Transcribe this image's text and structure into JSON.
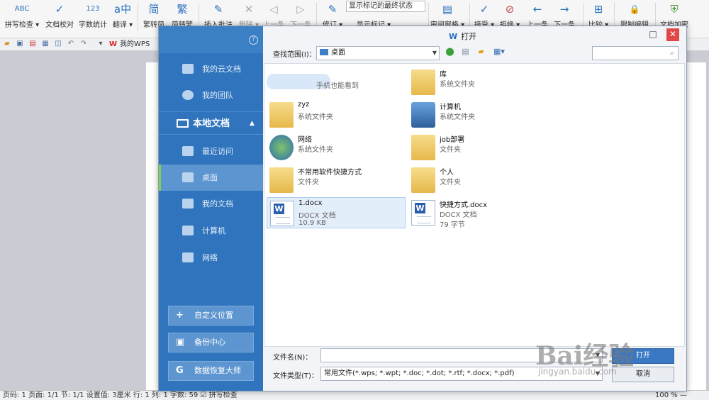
{
  "ribbon": [
    {
      "label": "拼写检查 ▾",
      "icon": "spell-check-icon",
      "glyph": "ABC"
    },
    {
      "label": "文档校对",
      "icon": "proofread-icon",
      "glyph": "✓"
    },
    {
      "label": "字数统计",
      "icon": "word-count-icon",
      "glyph": "123"
    },
    {
      "label": "翻译 ▾",
      "icon": "translate-icon",
      "glyph": "a中"
    },
    {
      "label": "繁转简",
      "icon": "trad-to-simp-icon",
      "glyph": "简"
    },
    {
      "label": "简转繁",
      "icon": "simp-to-trad-icon",
      "glyph": "繁"
    },
    {
      "label": "插入批注",
      "icon": "insert-comment-icon",
      "glyph": "✎"
    },
    {
      "label": "删除 ▾",
      "icon": "delete-comment-icon",
      "glyph": "✕"
    },
    {
      "label": "上一条",
      "icon": "prev-comment-icon",
      "glyph": "◁"
    },
    {
      "label": "下一条",
      "icon": "next-comment-icon",
      "glyph": "▷"
    },
    {
      "label": "修订 ▾",
      "icon": "track-changes-icon",
      "glyph": "✎"
    },
    {
      "label": "审阅窗格 ▾",
      "icon": "review-pane-icon",
      "glyph": "▤"
    },
    {
      "label": "接受 ▾",
      "icon": "accept-icon",
      "glyph": "✓"
    },
    {
      "label": "拒绝 ▾",
      "icon": "reject-icon",
      "glyph": "⊘"
    },
    {
      "label": "上一条",
      "icon": "prev-change-icon",
      "glyph": "←"
    },
    {
      "label": "下一条",
      "icon": "next-change-icon",
      "glyph": "→"
    },
    {
      "label": "比较 ▾",
      "icon": "compare-icon",
      "glyph": "⊞"
    },
    {
      "label": "限制编辑",
      "icon": "restrict-edit-icon",
      "glyph": "🔒"
    },
    {
      "label": "文档加密",
      "icon": "encrypt-icon",
      "glyph": "⛨"
    }
  ],
  "ribbon_markup_state": "显示标记的最终状态",
  "ribbon_show_markup": "显示标记 ▾",
  "qat": {
    "wps_tab": "我的WPS"
  },
  "statusbar": "页码: 1   页面: 1/1   节: 1/1   设置值: 3厘米   行: 1   列: 1   字数: 59   ☑ 拼写检查",
  "statusbar_zoom": "100 % —",
  "sidebar": {
    "help": "?",
    "items": [
      {
        "label": "我的云文档",
        "icon": "cloud-docs-icon"
      },
      {
        "label": "我的团队",
        "icon": "team-icon"
      },
      {
        "label": "最近访问",
        "icon": "recent-icon"
      },
      {
        "label": "桌面",
        "icon": "desktop-icon"
      },
      {
        "label": "我的文档",
        "icon": "my-docs-icon"
      },
      {
        "label": "计算机",
        "icon": "computer-icon"
      },
      {
        "label": "网络",
        "icon": "network-icon"
      }
    ],
    "section": "本地文档",
    "section_arrow": "▲",
    "buttons": [
      {
        "label": "自定义位置",
        "glyph": "+"
      },
      {
        "label": "备份中心",
        "glyph": "▣"
      },
      {
        "label": "数据恢复大师",
        "glyph": "G"
      }
    ]
  },
  "dialog": {
    "title": "打开",
    "title_icon": "W",
    "lookin_label": "查找范围(I)：",
    "lookin_value": "桌面",
    "filename_label": "文件名(N)：",
    "filename_value": "",
    "filetype_label": "文件类型(T)：",
    "filetype_value": "常用文件(*.wps; *.wpt; *.doc; *.dot; *.rtf; *.docx; *.pdf)",
    "open_btn": "打开",
    "cancel_btn": "取消",
    "minimize": "□",
    "close": "✕",
    "search_placeholder": ""
  },
  "files": [
    {
      "name": "",
      "type": "手机也能看到",
      "size": "",
      "icon": "cloud-folder-icon",
      "blurred": true
    },
    {
      "name": "库",
      "type": "系统文件夹",
      "size": "",
      "icon": "library-icon"
    },
    {
      "name": "zyz",
      "type": "系统文件夹",
      "size": "",
      "icon": "user-folder-icon"
    },
    {
      "name": "计算机",
      "type": "系统文件夹",
      "size": "",
      "icon": "computer-icon"
    },
    {
      "name": "网络",
      "type": "系统文件夹",
      "size": "",
      "icon": "network-icon"
    },
    {
      "name": "job部署",
      "type": "文件夹",
      "size": "",
      "icon": "folder-icon"
    },
    {
      "name": "不常用软件快捷方式",
      "type": "文件夹",
      "size": "",
      "icon": "folder-icon"
    },
    {
      "name": "个人",
      "type": "文件夹",
      "size": "",
      "icon": "folder-icon"
    },
    {
      "name": "1.docx",
      "type": "DOCX 文档",
      "size": "10.9 KB",
      "icon": "word-doc-icon",
      "selected": true
    },
    {
      "name": "快捷方式.docx",
      "type": "DOCX 文档",
      "size": "79 字节",
      "icon": "word-doc-icon"
    }
  ],
  "watermark": {
    "brand": "Bai经验",
    "url": "jingyan.baidu.com"
  }
}
